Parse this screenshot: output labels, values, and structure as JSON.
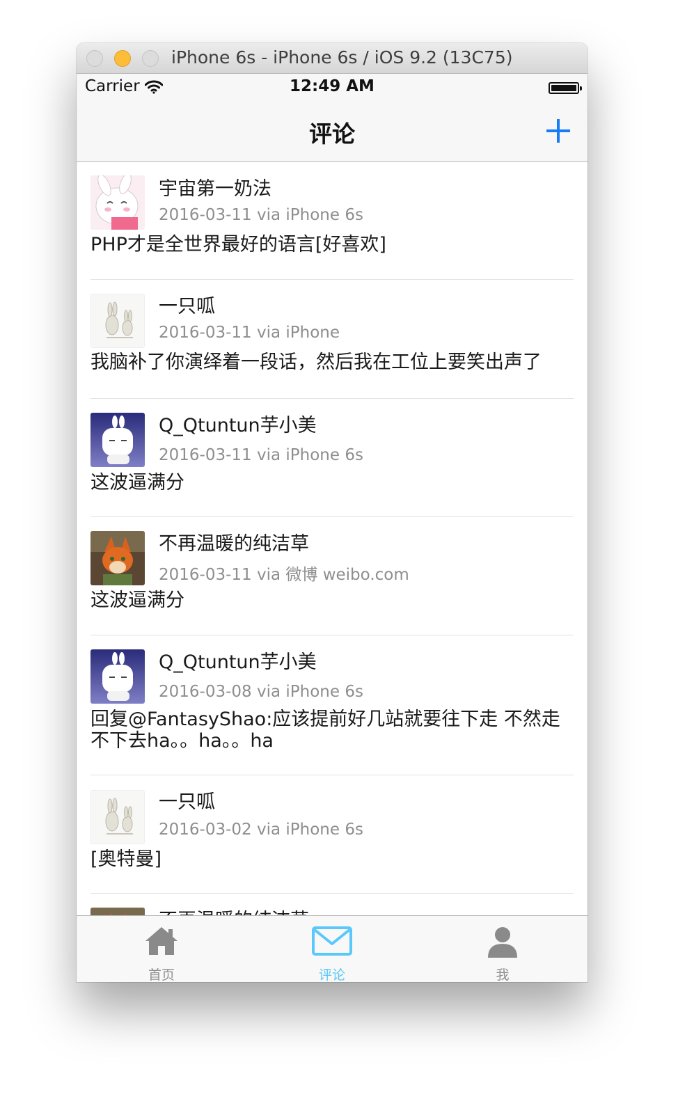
{
  "window": {
    "title": "iPhone 6s - iPhone 6s / iOS 9.2 (13C75)"
  },
  "status_bar": {
    "carrier": "Carrier",
    "time": "12:49 AM"
  },
  "nav": {
    "title": "评论",
    "add_icon": "plus-icon",
    "accent": "#1a7cf5"
  },
  "comments": [
    {
      "name": "宇宙第一奶法",
      "meta": "2016-03-11 via iPhone 6s",
      "text": "PHP才是全世界最好的语言[好喜欢]"
    },
    {
      "name": "一只呱",
      "meta": "2016-03-11 via iPhone",
      "text": "我脑补了你演绎着一段话，然后我在工位上要笑出声了"
    },
    {
      "name": "Q_Qtuntun芋小美",
      "meta": "2016-03-11 via iPhone 6s",
      "text": "这波逼满分"
    },
    {
      "name": "不再温暖的纯洁草",
      "meta": "2016-03-11 via 微博 weibo.com",
      "text": "这波逼满分"
    },
    {
      "name": "Q_Qtuntun芋小美",
      "meta": "2016-03-08 via iPhone 6s",
      "text": "回复@FantasyShao:应该提前好几站就要往下走 不然走不下去ha。。ha。。ha"
    },
    {
      "name": "一只呱",
      "meta": "2016-03-02 via iPhone 6s",
      "text": "[奥特曼]"
    },
    {
      "name": "不再温暖的纯洁草",
      "meta": "",
      "text": ""
    }
  ],
  "tabs": [
    {
      "label": "首页",
      "icon": "home-icon",
      "active": false
    },
    {
      "label": "评论",
      "icon": "mail-icon",
      "active": true
    },
    {
      "label": "我",
      "icon": "user-icon",
      "active": false
    }
  ],
  "colors": {
    "tab_active": "#5ac8fa",
    "tab_inactive": "#8e8e8e"
  }
}
